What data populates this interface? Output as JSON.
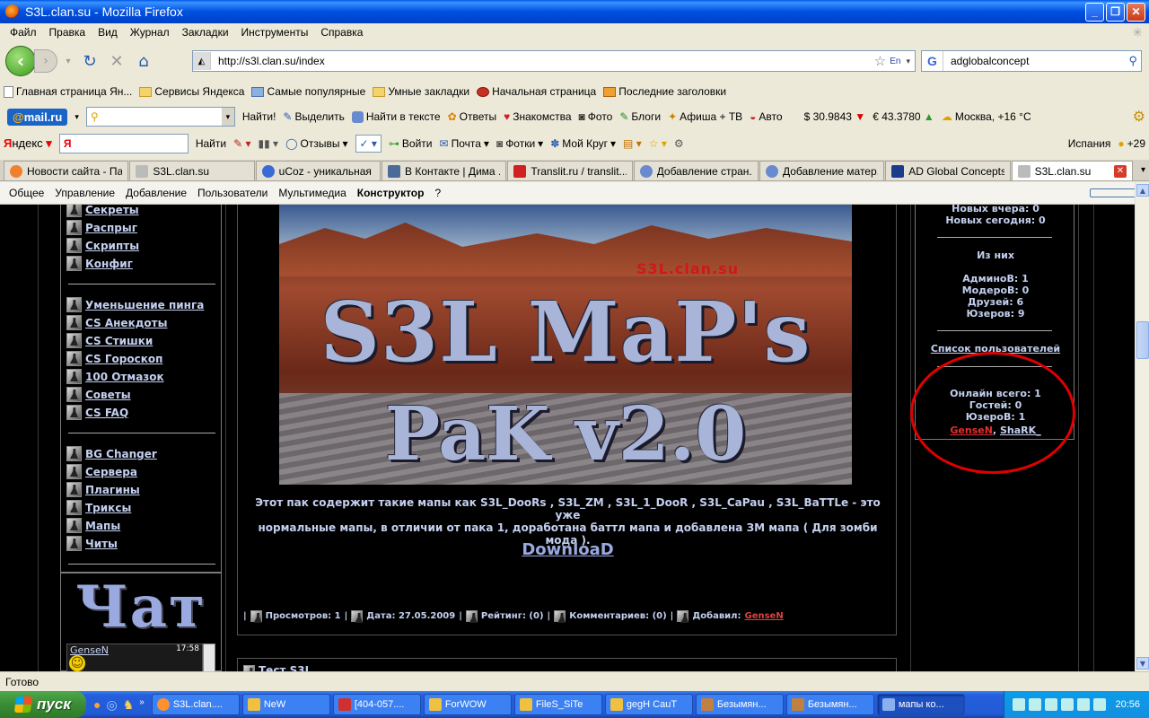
{
  "window": {
    "title": "S3L.clan.su - Mozilla Firefox",
    "min": "_",
    "max": "❐",
    "close": "✕"
  },
  "menu": [
    "Файл",
    "Правка",
    "Вид",
    "Журнал",
    "Закладки",
    "Инструменты",
    "Справка"
  ],
  "nav": {
    "url": "http://s3l.clan.su/index",
    "lang": "En",
    "search_value": "adglobalconcept"
  },
  "bookmarks": [
    "Главная страница Ян...",
    "Сервисы Яндекса",
    "Самые популярные",
    "Умные закладки",
    "Начальная страница",
    "Последние заголовки"
  ],
  "mailbar": {
    "logo_a": "@",
    "logo_b": "mail.ru",
    "find": "Найти!",
    "highlight": "Выделить",
    "find_in_text": "Найти в тексте",
    "items": [
      "Ответы",
      "Знакомства",
      "Фото",
      "Блоги",
      "Афиша + ТВ",
      "Авто"
    ],
    "usd": "$ 30.9843",
    "eur": "€ 43.3780",
    "weather": "Москва, +16 °C"
  },
  "yabar": {
    "logo_a": "Я",
    "logo_b": "ндекс",
    "find": "Найти",
    "reviews": "Отзывы",
    "login": "Войти",
    "mail": "Почта",
    "photos": "Фотки",
    "circle": "Мой Круг",
    "region": "Испания",
    "temp": "+29"
  },
  "tabs": [
    "Новости сайта - Па...",
    "S3L.clan.su",
    "uCoz - уникальная ...",
    "В Контакте | Дима ...",
    "Translit.ru / translit....",
    "Добавление стран...",
    "Добавление матер...",
    "AD Global Concepts ...",
    "S3L.clan.su"
  ],
  "ucoz_menu": [
    "Общее",
    "Управление",
    "Добавление",
    "Пользователи",
    "Мультимедиа",
    "Конструктор",
    "?"
  ],
  "left_links_1": [
    "Секреты",
    "Распрыг",
    "Скрипты",
    "Конфиг"
  ],
  "left_links_2": [
    "Уменьшение пинга",
    "CS Анекдоты",
    "CS Стишки",
    "CS Гороскоп",
    "100 Отмазок",
    "Советы",
    "CS FAQ"
  ],
  "left_links_3": [
    "BG Changer",
    "Сервера",
    "Плагины",
    "Триксы",
    "Мапы",
    "Читы"
  ],
  "chat": {
    "logo": "Чат",
    "user": "GenseN",
    "time": "17:58",
    "emoji": "☺"
  },
  "banner": {
    "site": "S3L.clan.su",
    "line1": "S3L MaP's",
    "line2": "PaK v2.0"
  },
  "post": {
    "desc1": "Этот пак содержит такие мапы как S3L_DooRs , S3L_ZM , S3L_1_DooR , S3L_CaPau , S3L_BaTTLe - это уже",
    "desc2": "нормальные мапы, в отличии от пака 1, доработана баттл мапа и добавлена ЗМ мапа ( Для зомби мода ).",
    "download": "DownloaD",
    "views": "Просмотров: 1",
    "date": "Дата: 27.05.2009",
    "rating": "Рейтинг: (0)",
    "comments": "Комментариев: (0)",
    "added": "Добавил:",
    "author": "GenseN",
    "next_title": "Тест S3L"
  },
  "stats": {
    "new_yesterday": "Новых вчера: 0",
    "new_today": "Новых сегодня: 0",
    "of_them": "Из них",
    "admins": "АдминоВ: 1",
    "mods": "МодероВ: 0",
    "friends": "Друзей: 6",
    "users": "Юзеров: 9",
    "user_list": "Список пользователей",
    "online": "Онлайн всего: 1",
    "guests": "Гостей: 0",
    "online_users": "ЮзероВ: 1",
    "u1": "GenseN",
    "u2": "ShaRK_"
  },
  "status": "Готово",
  "taskbar": {
    "start": "пуск",
    "tasks": [
      "S3L.clan....",
      "NeW",
      "[404-057....",
      "ForWOW",
      "FileS_SiTe",
      "gegH  CauT",
      "Безымян...",
      "Безымян...",
      "мапы ко..."
    ],
    "clock": "20:56"
  },
  "colors": {
    "accent": "#0058e6",
    "link": "#c4d0f0",
    "highlight_oval": "#e00000",
    "user_red": "#e03030"
  }
}
